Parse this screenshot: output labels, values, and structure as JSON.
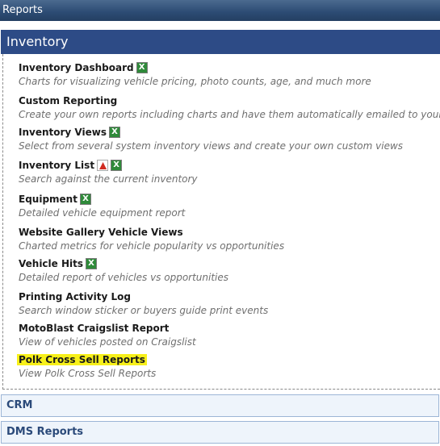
{
  "topbar": {
    "title": "Reports"
  },
  "inventory": {
    "header": "Inventory",
    "items": [
      {
        "title": "Inventory Dashboard",
        "desc": "Charts for visualizing vehicle pricing, photo counts, age, and much more",
        "icons": [
          "excel-icon"
        ]
      },
      {
        "title": "Custom Reporting",
        "desc": "Create your own reports including charts and have them automatically emailed to yourself",
        "icons": []
      },
      {
        "title": "Inventory Views",
        "desc": "Select from several system inventory views and create your own custom views",
        "icons": [
          "excel-icon"
        ]
      },
      {
        "title": "Inventory List",
        "desc": "Search against the current inventory",
        "icons": [
          "pdf-icon",
          "excel-icon"
        ]
      },
      {
        "title": "Equipment",
        "desc": "Detailed vehicle equipment report",
        "icons": [
          "excel-icon"
        ]
      },
      {
        "title": "Website Gallery Vehicle Views",
        "desc": "Charted metrics for vehicle popularity vs opportunities",
        "icons": []
      },
      {
        "title": "Vehicle Hits",
        "desc": "Detailed report of vehicles vs opportunities",
        "icons": [
          "excel-icon"
        ]
      },
      {
        "title": "Printing Activity Log",
        "desc": "Search window sticker or buyers guide print events",
        "icons": []
      },
      {
        "title": "MotoBlast Craigslist Report",
        "desc": "View of vehicles posted on Craigslist",
        "icons": []
      },
      {
        "title": "Polk Cross Sell Reports",
        "desc": "View Polk Cross Sell Reports",
        "icons": [],
        "highlight_color": "#f7f01a"
      }
    ]
  },
  "sections": [
    {
      "label": "CRM"
    },
    {
      "label": "DMS Reports"
    }
  ],
  "colors": {
    "header_bg": "#2d4b86",
    "topbar_bg": "#2c4b73",
    "section_bg": "#eef4fb",
    "highlight": "#f7f01a"
  }
}
